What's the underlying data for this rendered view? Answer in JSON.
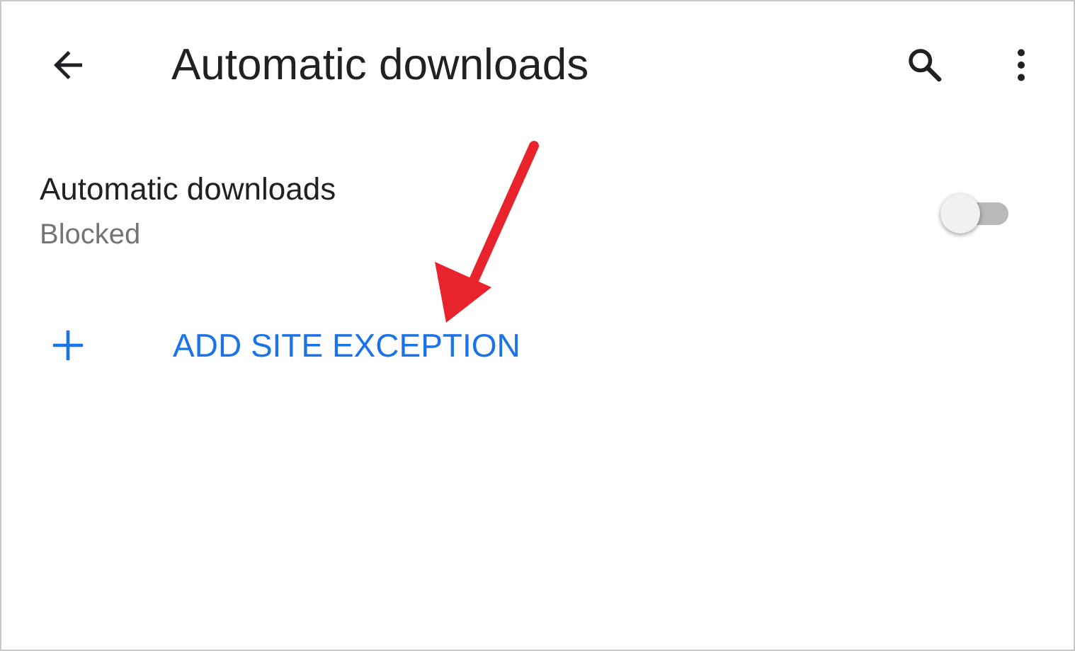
{
  "app_bar": {
    "title": "Automatic downloads"
  },
  "setting": {
    "title": "Automatic downloads",
    "subtitle": "Blocked",
    "on": false
  },
  "add_exception": {
    "label": "ADD SITE EXCEPTION"
  }
}
